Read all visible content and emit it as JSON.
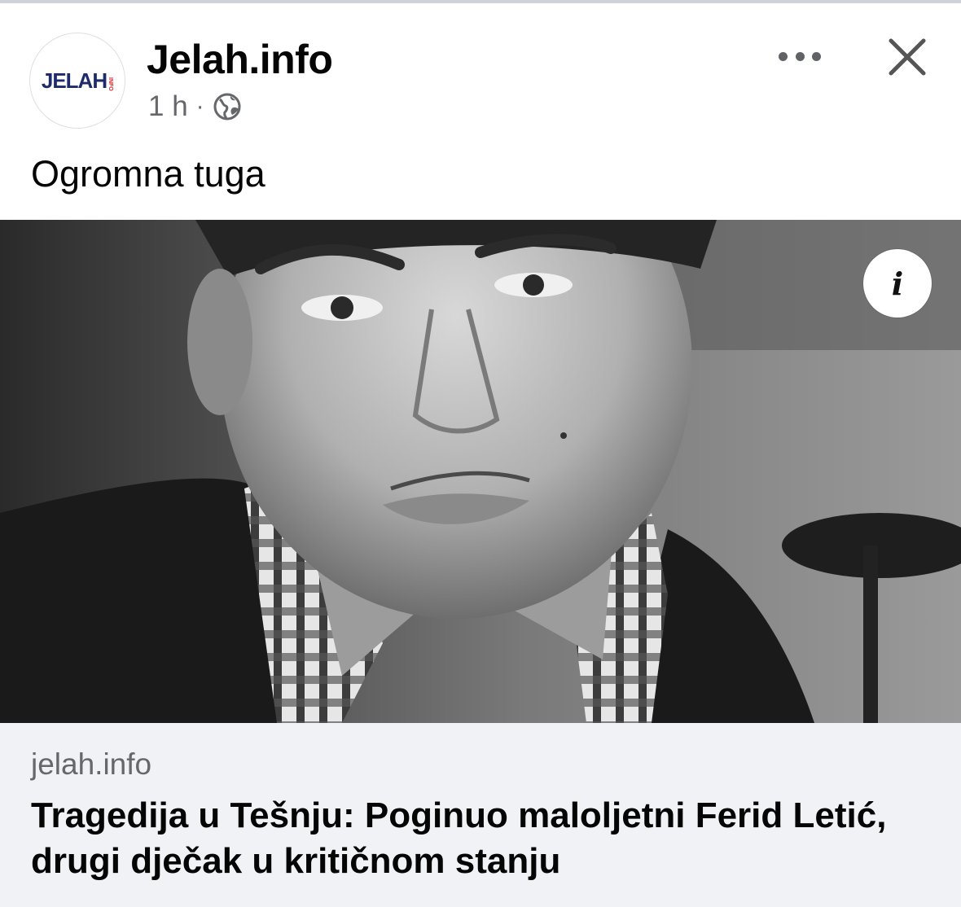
{
  "post": {
    "page_name": "Jelah.info",
    "timestamp": "1 h",
    "separator": "·",
    "audience_icon": "globe-icon",
    "caption": "Ogromna tuga"
  },
  "avatar": {
    "logo_text": "JELAH",
    "logo_sub": "INFO",
    "brand_color": "#1d2b6b",
    "accent_color": "#e0212a"
  },
  "actions": {
    "more_icon": "more-options-icon",
    "close_icon": "close-icon"
  },
  "media": {
    "info_glyph": "i"
  },
  "link_preview": {
    "domain": "jelah.info",
    "title": "Tragedija u Tešnju: Poginuo maloljetni Ferid Letić, drugi dječak u kritičnom stanju"
  }
}
